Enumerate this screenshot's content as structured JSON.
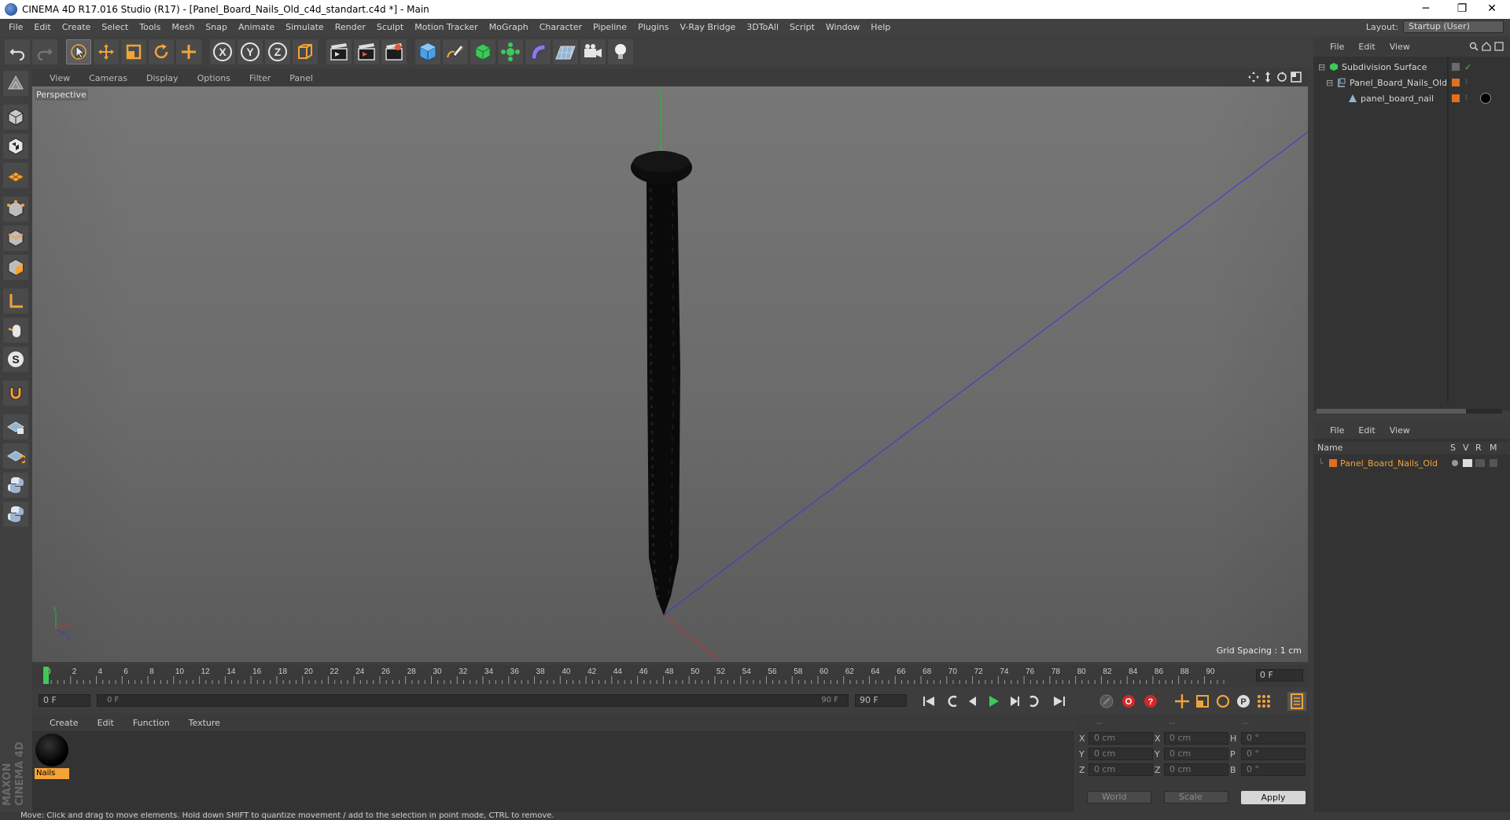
{
  "window": {
    "title": "CINEMA 4D R17.016 Studio (R17) - [Panel_Board_Nails_Old_c4d_standart.c4d *] - Main",
    "minimize": "─",
    "restore": "❐",
    "close": "✕"
  },
  "menubar": {
    "items": [
      "File",
      "Edit",
      "Create",
      "Select",
      "Tools",
      "Mesh",
      "Snap",
      "Animate",
      "Simulate",
      "Render",
      "Sculpt",
      "Motion Tracker",
      "MoGraph",
      "Character",
      "Pipeline",
      "Plugins",
      "V-Ray Bridge",
      "3DToAll",
      "Script",
      "Window",
      "Help"
    ],
    "layout_label": "Layout:",
    "layout_value": "Startup (User)"
  },
  "toolbar": {
    "axis_x": "X",
    "axis_y": "Y",
    "axis_z": "Z"
  },
  "viewport": {
    "menus": [
      "View",
      "Cameras",
      "Display",
      "Options",
      "Filter",
      "Panel"
    ],
    "label": "Perspective",
    "grid_spacing": "Grid Spacing : 1 cm"
  },
  "timeline": {
    "ticks": [
      "0",
      "2",
      "4",
      "6",
      "8",
      "10",
      "12",
      "14",
      "16",
      "18",
      "20",
      "22",
      "24",
      "26",
      "28",
      "30",
      "32",
      "34",
      "36",
      "38",
      "40",
      "42",
      "44",
      "46",
      "48",
      "50",
      "52",
      "54",
      "56",
      "58",
      "60",
      "62",
      "64",
      "66",
      "68",
      "70",
      "72",
      "74",
      "76",
      "78",
      "80",
      "82",
      "84",
      "86",
      "88",
      "90"
    ],
    "current_frame": "0 F",
    "start_field": "0 F",
    "range_start": "0 F",
    "range_end": "90 F",
    "end_field": "90 F"
  },
  "material_manager": {
    "menus": [
      "Create",
      "Edit",
      "Function",
      "Texture"
    ],
    "materials": [
      {
        "name": "Nails"
      }
    ]
  },
  "coordinates": {
    "header": [
      "--",
      "--",
      "--"
    ],
    "rows": [
      {
        "a_label": "X",
        "a_value": "0 cm",
        "b_label": "X",
        "b_value": "0 cm",
        "c_label": "H",
        "c_value": "0 °"
      },
      {
        "a_label": "Y",
        "a_value": "0 cm",
        "b_label": "Y",
        "b_value": "0 cm",
        "c_label": "P",
        "c_value": "0 °"
      },
      {
        "a_label": "Z",
        "a_value": "0 cm",
        "b_label": "Z",
        "b_value": "0 cm",
        "c_label": "B",
        "c_value": "0 °"
      }
    ],
    "space": "World",
    "mode": "Scale",
    "apply": "Apply"
  },
  "object_manager": {
    "menus": [
      "File",
      "Edit",
      "View"
    ],
    "objects": [
      {
        "name": "Subdivision Surface",
        "indent": 0
      },
      {
        "name": "Panel_Board_Nails_Old",
        "indent": 1
      },
      {
        "name": "panel_board_nail",
        "indent": 2
      }
    ]
  },
  "attribute_manager": {
    "menus": [
      "File",
      "Edit",
      "View"
    ],
    "columns": {
      "name": "Name",
      "s": "S",
      "v": "V",
      "r": "R",
      "m": "M"
    },
    "rows": [
      {
        "name": "Panel_Board_Nails_Old"
      }
    ]
  },
  "statusbar": {
    "text": "Move: Click and drag to move elements. Hold down SHIFT to quantize movement / add to the selection in point mode, CTRL to remove."
  },
  "brand": {
    "logo": "MAXON CINEMA 4D"
  },
  "colors": {
    "accent": "#f2a33a",
    "y_axis": "#34b234",
    "x_axis": "#c83232",
    "z_axis": "#3a3ad0"
  }
}
